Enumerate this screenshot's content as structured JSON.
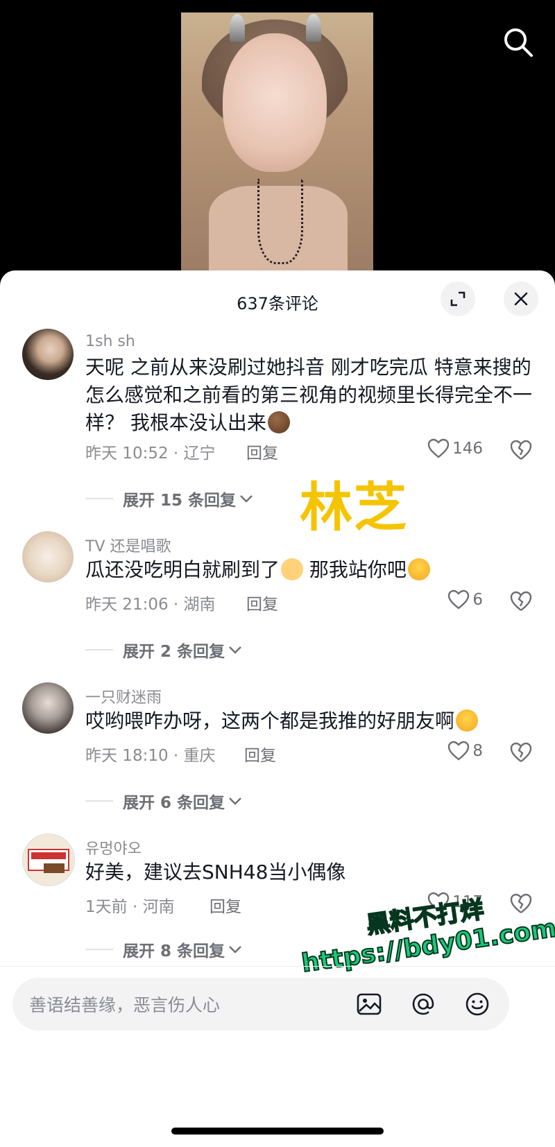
{
  "sheet": {
    "title": "637条评论",
    "expand_label": "expand-icon",
    "close_label": "close-icon"
  },
  "comments": [
    {
      "username": "1sh sh",
      "text": "天呢 之前从来没刷过她抖音 刚才吃完瓜 特意来搜的 怎么感觉和之前看的第三视角的视频里长得完全不一样？ 我根本没认出来",
      "meta": "昨天 10:52 · 辽宁",
      "reply": "回复",
      "likes": "146",
      "expand": "展开 15 条回复"
    },
    {
      "username": "TV 还是唱歌",
      "text": "瓜还没吃明白就刷到了",
      "text2": "那我站你吧",
      "meta": "昨天 21:06 · 湖南",
      "reply": "回复",
      "likes": "6",
      "expand": "展开 2 条回复"
    },
    {
      "username": "一只财迷雨",
      "text": "哎哟喂咋办呀，这两个都是我推的好朋友啊",
      "meta": "昨天 18:10 · 重庆",
      "reply": "回复",
      "likes": "8",
      "expand": "展开 6 条回复"
    },
    {
      "username": "유멍야오",
      "text": "好美，建议去SNH48当小偶像",
      "meta": "1天前 · 河南",
      "reply": "回复",
      "likes": "117",
      "expand": "展开 8 条回复"
    }
  ],
  "overlay": {
    "name": "林芝",
    "watermark_line1": "黑料不打烊",
    "watermark_line2": "https://bdy01.com"
  },
  "input": {
    "placeholder": "善语结善缘，恶言伤人心"
  },
  "colors": {
    "accent_yellow": "#f5c400",
    "watermark_green": "#19c97a",
    "text_primary": "#161823",
    "text_secondary": "#8a8b91"
  },
  "icons": [
    "search-icon",
    "expand-icon",
    "close-icon",
    "heart-icon",
    "broken-heart-icon",
    "chevron-down-icon",
    "image-icon",
    "at-icon",
    "smile-icon"
  ]
}
